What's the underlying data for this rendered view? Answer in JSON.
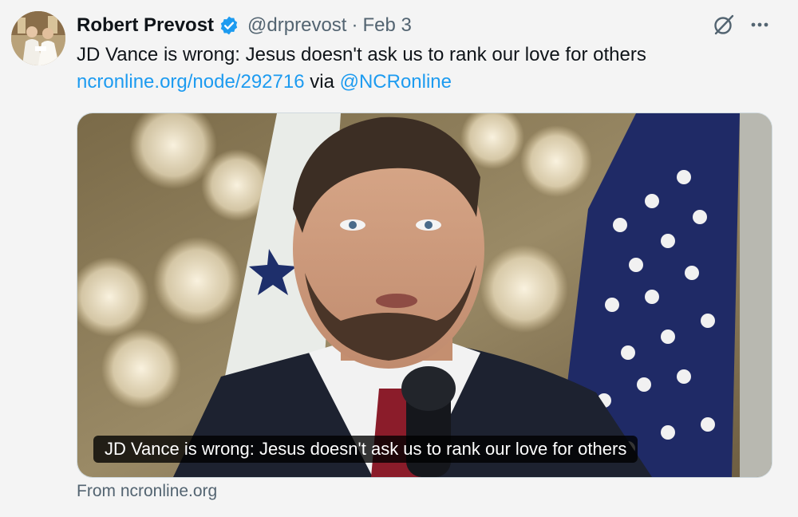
{
  "tweet": {
    "display_name": "Robert Prevost",
    "handle": "@drprevost",
    "separator": "·",
    "date": "Feb 3",
    "text": "JD Vance is wrong: Jesus doesn't ask us to rank our love for others",
    "link_text": "ncronline.org/node/292716",
    "via_text": " via ",
    "mention": "@NCRonline"
  },
  "card": {
    "title": "JD Vance is wrong: Jesus doesn't ask us to rank our love for others",
    "source": "From ncronline.org"
  },
  "icons": {
    "verified": "verified-badge-icon",
    "grok": "grok-icon",
    "more": "more-icon"
  },
  "colors": {
    "link": "#1d9bf0",
    "verified": "#1d9bf0",
    "secondary_text": "#536471",
    "background": "#f4f4f4"
  }
}
